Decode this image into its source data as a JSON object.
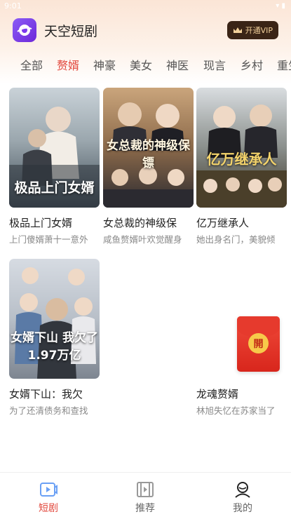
{
  "status_bar": {
    "time": "9:01",
    "icons": "▾ ▮"
  },
  "app": {
    "title": "天空短剧",
    "vip_label": "开通VIP",
    "vip_icon": "crown-icon"
  },
  "categories": [
    {
      "label": "全部",
      "active": false
    },
    {
      "label": "赘婿",
      "active": true
    },
    {
      "label": "神豪",
      "active": false
    },
    {
      "label": "美女",
      "active": false
    },
    {
      "label": "神医",
      "active": false
    },
    {
      "label": "现言",
      "active": false
    },
    {
      "label": "乡村",
      "active": false
    },
    {
      "label": "重生",
      "active": false
    }
  ],
  "dramas": [
    {
      "title": "极品上门女婿",
      "desc": "上门傻婿萧十一意外",
      "poster_text": "极品上门女婿"
    },
    {
      "title": "女总裁的神级保",
      "desc": "咸鱼赘婿叶欢觉醒身",
      "poster_text": "女总裁的神级保镖"
    },
    {
      "title": "亿万继承人",
      "desc": "她出身名门，美貌倾",
      "poster_text": "亿万继承人"
    },
    {
      "title": "女婿下山：我欠",
      "desc": "为了还清债务和查找",
      "poster_text": "女婿下山 我欠了1.97万亿"
    },
    {
      "title": "龙魂赘婿",
      "desc": "林旭失忆在苏家当了"
    }
  ],
  "red_envelope": {
    "label": "開"
  },
  "bottom_nav": [
    {
      "label": "短剧",
      "icon": "video-icon",
      "active": true
    },
    {
      "label": "推荐",
      "icon": "film-icon",
      "active": false
    },
    {
      "label": "我的",
      "icon": "profile-icon",
      "active": false
    }
  ],
  "colors": {
    "accent": "#e2483d",
    "vip_bg": "#3a2416",
    "vip_text": "#f2d09a"
  }
}
